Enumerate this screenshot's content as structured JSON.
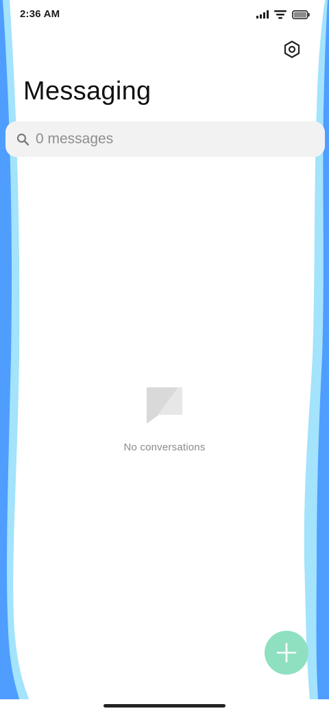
{
  "status_bar": {
    "time": "2:36 AM",
    "icons": [
      "signal-icon",
      "wifi-icon",
      "battery-icon"
    ]
  },
  "header": {
    "title": "Messaging",
    "settings_icon": "settings-icon"
  },
  "search": {
    "placeholder": "0 messages",
    "value": ""
  },
  "empty_state": {
    "icon": "chat-bubble-icon",
    "text": "No conversations"
  },
  "fab": {
    "icon": "plus-icon",
    "color": "#8fe0c1"
  },
  "colors": {
    "edge_dark_blue": "#4f9dff",
    "edge_light_blue": "#a3e3fb",
    "search_background": "#f2f2f2"
  }
}
